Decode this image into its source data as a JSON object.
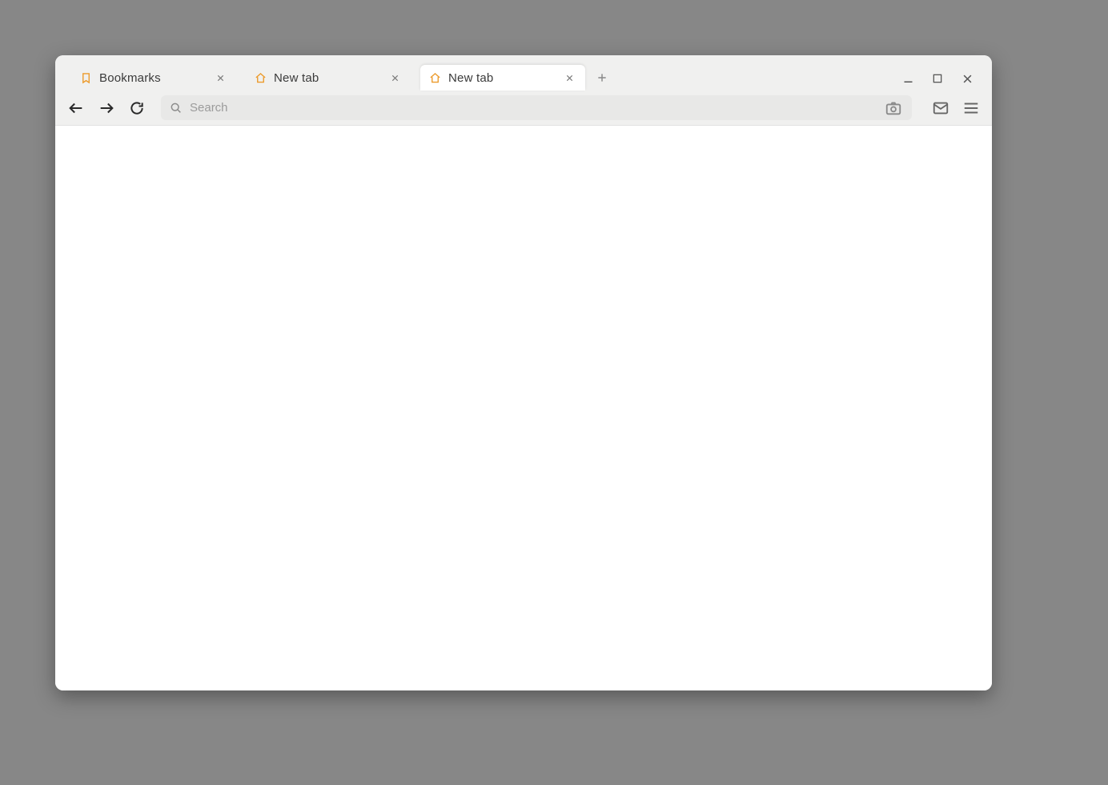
{
  "colors": {
    "accent": "#ec9a2a"
  },
  "tabs": [
    {
      "label": "Bookmarks",
      "icon": "bookmark",
      "active": false
    },
    {
      "label": "New tab",
      "icon": "home",
      "active": false
    },
    {
      "label": "New tab",
      "icon": "home",
      "active": true
    }
  ],
  "addressbar": {
    "placeholder": "Search",
    "value": ""
  }
}
